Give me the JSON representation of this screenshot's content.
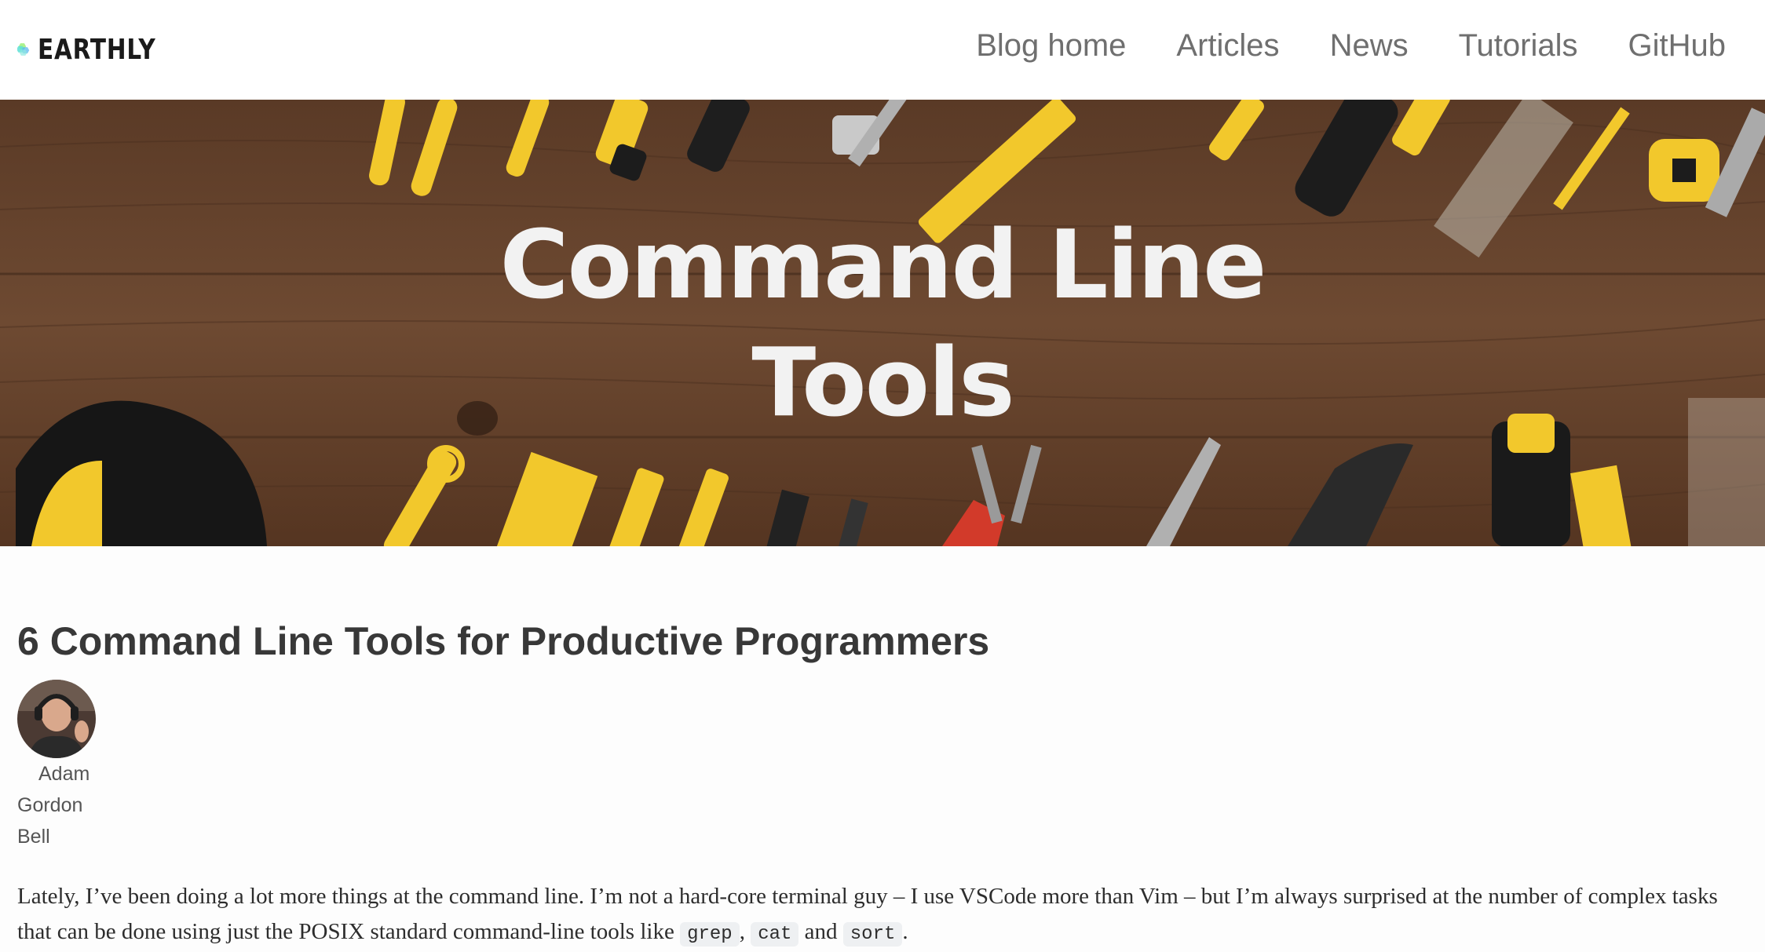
{
  "brand": {
    "name": "EARTHLY",
    "colors": {
      "teal": "#5ce0d6",
      "green": "#9ef07a",
      "blue": "#5cb8f0"
    }
  },
  "nav": {
    "items": [
      {
        "label": "Blog home"
      },
      {
        "label": "Articles"
      },
      {
        "label": "News"
      },
      {
        "label": "Tutorials"
      },
      {
        "label": "GitHub"
      }
    ]
  },
  "hero": {
    "line1": "Command Line",
    "line2": "Tools",
    "colors": {
      "wood": "#6b4630",
      "accent": "#f2c82c",
      "text": "#f2f2f2"
    }
  },
  "article": {
    "title": "6 Command Line Tools for Productive Programmers",
    "author": {
      "line1": "Adam",
      "line2": "Gordon",
      "line3": "Bell"
    },
    "intro": {
      "text": "Lately, I’ve been doing a lot more things at the command line. I’m not a hard-core terminal guy – I use VSCode more than Vim – but I’m always surprised at the number of complex tasks that can be done using just the POSIX standard command-line tools like ",
      "code1": "grep",
      "sep1": ", ",
      "code2": "cat",
      "sep2": " and ",
      "code3": "sort",
      "end": "."
    }
  }
}
